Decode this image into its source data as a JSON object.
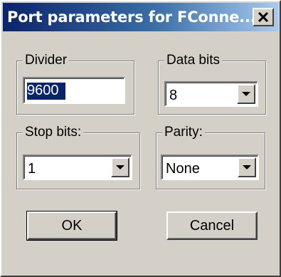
{
  "window": {
    "title": "Port parameters for FConne...",
    "close_glyph": "✕"
  },
  "divider": {
    "label": "Divider",
    "value": "9600"
  },
  "data_bits": {
    "label": "Data bits",
    "value": "8"
  },
  "stop_bits": {
    "label": "Stop bits:",
    "value": "1"
  },
  "parity": {
    "label": "Parity:",
    "value": "None"
  },
  "buttons": {
    "ok": "OK",
    "cancel": "Cancel"
  },
  "icons": {
    "close": "close-icon",
    "dropdown": "chevron-down-icon"
  },
  "colors": {
    "title_bar_start": "#0a246a",
    "title_bar_end": "#a6caf0",
    "face": "#d4d0c8",
    "selection": "#0a246a"
  }
}
